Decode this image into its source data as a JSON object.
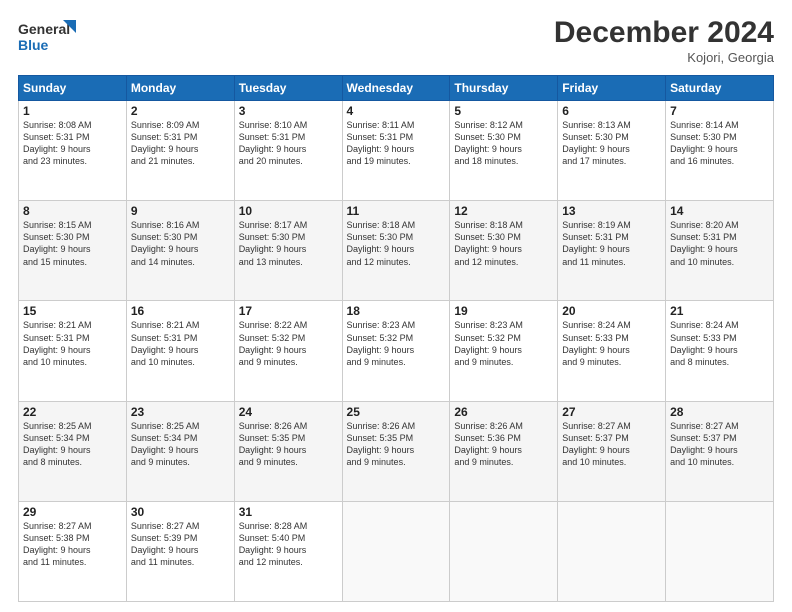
{
  "header": {
    "logo_line1": "General",
    "logo_line2": "Blue",
    "month": "December 2024",
    "location": "Kojori, Georgia"
  },
  "weekdays": [
    "Sunday",
    "Monday",
    "Tuesday",
    "Wednesday",
    "Thursday",
    "Friday",
    "Saturday"
  ],
  "weeks": [
    [
      {
        "day": "1",
        "lines": [
          "Sunrise: 8:08 AM",
          "Sunset: 5:31 PM",
          "Daylight: 9 hours",
          "and 23 minutes."
        ]
      },
      {
        "day": "2",
        "lines": [
          "Sunrise: 8:09 AM",
          "Sunset: 5:31 PM",
          "Daylight: 9 hours",
          "and 21 minutes."
        ]
      },
      {
        "day": "3",
        "lines": [
          "Sunrise: 8:10 AM",
          "Sunset: 5:31 PM",
          "Daylight: 9 hours",
          "and 20 minutes."
        ]
      },
      {
        "day": "4",
        "lines": [
          "Sunrise: 8:11 AM",
          "Sunset: 5:31 PM",
          "Daylight: 9 hours",
          "and 19 minutes."
        ]
      },
      {
        "day": "5",
        "lines": [
          "Sunrise: 8:12 AM",
          "Sunset: 5:30 PM",
          "Daylight: 9 hours",
          "and 18 minutes."
        ]
      },
      {
        "day": "6",
        "lines": [
          "Sunrise: 8:13 AM",
          "Sunset: 5:30 PM",
          "Daylight: 9 hours",
          "and 17 minutes."
        ]
      },
      {
        "day": "7",
        "lines": [
          "Sunrise: 8:14 AM",
          "Sunset: 5:30 PM",
          "Daylight: 9 hours",
          "and 16 minutes."
        ]
      }
    ],
    [
      {
        "day": "8",
        "lines": [
          "Sunrise: 8:15 AM",
          "Sunset: 5:30 PM",
          "Daylight: 9 hours",
          "and 15 minutes."
        ]
      },
      {
        "day": "9",
        "lines": [
          "Sunrise: 8:16 AM",
          "Sunset: 5:30 PM",
          "Daylight: 9 hours",
          "and 14 minutes."
        ]
      },
      {
        "day": "10",
        "lines": [
          "Sunrise: 8:17 AM",
          "Sunset: 5:30 PM",
          "Daylight: 9 hours",
          "and 13 minutes."
        ]
      },
      {
        "day": "11",
        "lines": [
          "Sunrise: 8:18 AM",
          "Sunset: 5:30 PM",
          "Daylight: 9 hours",
          "and 12 minutes."
        ]
      },
      {
        "day": "12",
        "lines": [
          "Sunrise: 8:18 AM",
          "Sunset: 5:30 PM",
          "Daylight: 9 hours",
          "and 12 minutes."
        ]
      },
      {
        "day": "13",
        "lines": [
          "Sunrise: 8:19 AM",
          "Sunset: 5:31 PM",
          "Daylight: 9 hours",
          "and 11 minutes."
        ]
      },
      {
        "day": "14",
        "lines": [
          "Sunrise: 8:20 AM",
          "Sunset: 5:31 PM",
          "Daylight: 9 hours",
          "and 10 minutes."
        ]
      }
    ],
    [
      {
        "day": "15",
        "lines": [
          "Sunrise: 8:21 AM",
          "Sunset: 5:31 PM",
          "Daylight: 9 hours",
          "and 10 minutes."
        ]
      },
      {
        "day": "16",
        "lines": [
          "Sunrise: 8:21 AM",
          "Sunset: 5:31 PM",
          "Daylight: 9 hours",
          "and 10 minutes."
        ]
      },
      {
        "day": "17",
        "lines": [
          "Sunrise: 8:22 AM",
          "Sunset: 5:32 PM",
          "Daylight: 9 hours",
          "and 9 minutes."
        ]
      },
      {
        "day": "18",
        "lines": [
          "Sunrise: 8:23 AM",
          "Sunset: 5:32 PM",
          "Daylight: 9 hours",
          "and 9 minutes."
        ]
      },
      {
        "day": "19",
        "lines": [
          "Sunrise: 8:23 AM",
          "Sunset: 5:32 PM",
          "Daylight: 9 hours",
          "and 9 minutes."
        ]
      },
      {
        "day": "20",
        "lines": [
          "Sunrise: 8:24 AM",
          "Sunset: 5:33 PM",
          "Daylight: 9 hours",
          "and 9 minutes."
        ]
      },
      {
        "day": "21",
        "lines": [
          "Sunrise: 8:24 AM",
          "Sunset: 5:33 PM",
          "Daylight: 9 hours",
          "and 8 minutes."
        ]
      }
    ],
    [
      {
        "day": "22",
        "lines": [
          "Sunrise: 8:25 AM",
          "Sunset: 5:34 PM",
          "Daylight: 9 hours",
          "and 8 minutes."
        ]
      },
      {
        "day": "23",
        "lines": [
          "Sunrise: 8:25 AM",
          "Sunset: 5:34 PM",
          "Daylight: 9 hours",
          "and 9 minutes."
        ]
      },
      {
        "day": "24",
        "lines": [
          "Sunrise: 8:26 AM",
          "Sunset: 5:35 PM",
          "Daylight: 9 hours",
          "and 9 minutes."
        ]
      },
      {
        "day": "25",
        "lines": [
          "Sunrise: 8:26 AM",
          "Sunset: 5:35 PM",
          "Daylight: 9 hours",
          "and 9 minutes."
        ]
      },
      {
        "day": "26",
        "lines": [
          "Sunrise: 8:26 AM",
          "Sunset: 5:36 PM",
          "Daylight: 9 hours",
          "and 9 minutes."
        ]
      },
      {
        "day": "27",
        "lines": [
          "Sunrise: 8:27 AM",
          "Sunset: 5:37 PM",
          "Daylight: 9 hours",
          "and 10 minutes."
        ]
      },
      {
        "day": "28",
        "lines": [
          "Sunrise: 8:27 AM",
          "Sunset: 5:37 PM",
          "Daylight: 9 hours",
          "and 10 minutes."
        ]
      }
    ],
    [
      {
        "day": "29",
        "lines": [
          "Sunrise: 8:27 AM",
          "Sunset: 5:38 PM",
          "Daylight: 9 hours",
          "and 11 minutes."
        ]
      },
      {
        "day": "30",
        "lines": [
          "Sunrise: 8:27 AM",
          "Sunset: 5:39 PM",
          "Daylight: 9 hours",
          "and 11 minutes."
        ]
      },
      {
        "day": "31",
        "lines": [
          "Sunrise: 8:28 AM",
          "Sunset: 5:40 PM",
          "Daylight: 9 hours",
          "and 12 minutes."
        ]
      },
      null,
      null,
      null,
      null
    ]
  ]
}
